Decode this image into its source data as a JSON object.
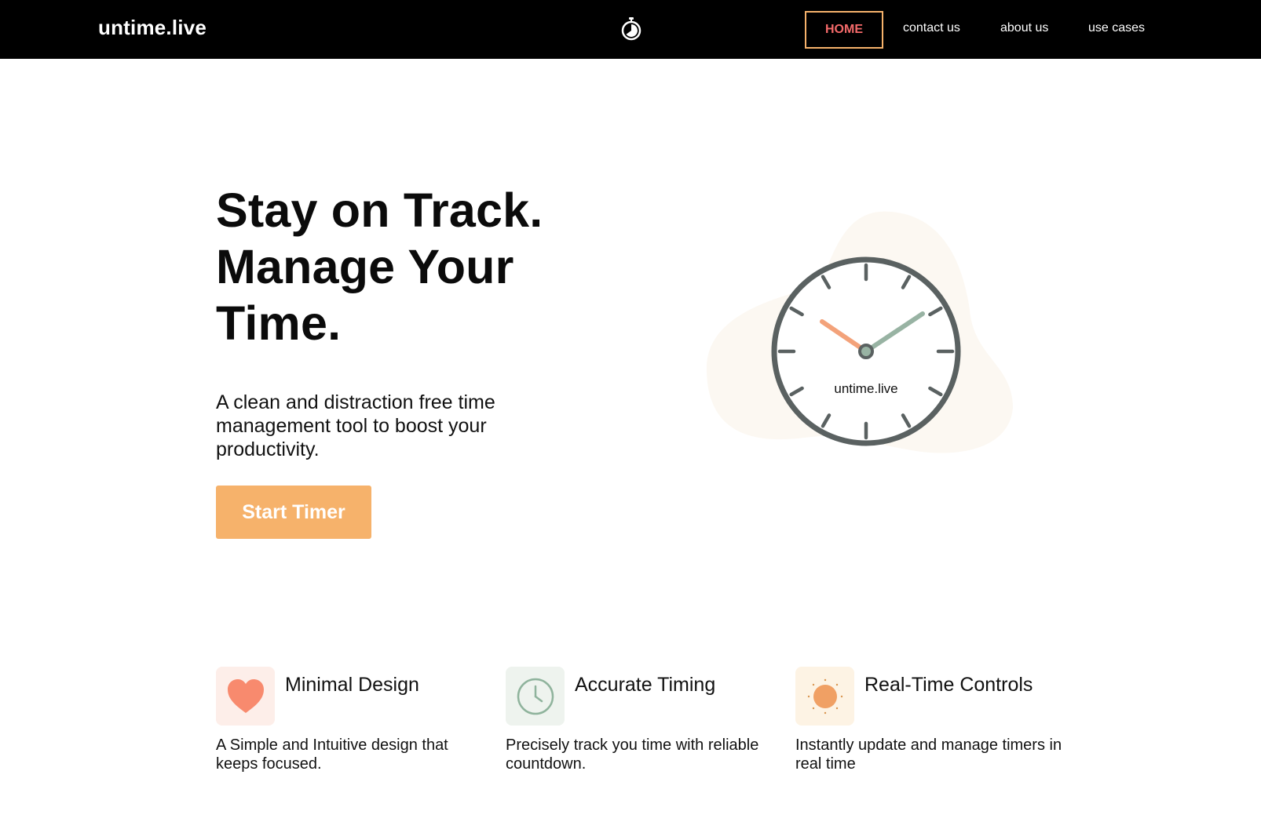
{
  "nav": {
    "brand": "untime.live",
    "logo_icon": "stopwatch-icon",
    "links": [
      {
        "label": "HOME",
        "active": true
      },
      {
        "label": "contact us"
      },
      {
        "label": "about us"
      },
      {
        "label": "use cases"
      }
    ]
  },
  "hero": {
    "title_lines": [
      "Stay on Track.",
      "Manage Your",
      "Time."
    ],
    "subtitle": "A clean and distraction free time management tool to boost your productivity.",
    "cta_label": "Start Timer",
    "clock_label": "untime.live"
  },
  "features": [
    {
      "icon": "heart-icon",
      "title": "Minimal Design",
      "description": "A Simple and Intuitive design that keeps focused."
    },
    {
      "icon": "clock-icon",
      "title": "Accurate Timing",
      "description": "Precisely track you time with reliable countdown."
    },
    {
      "icon": "sun-icon",
      "title": "Real-Time Controls",
      "description": "Instantly update and manage timers in real time"
    }
  ],
  "colors": {
    "nav_bg": "#000000",
    "accent": "#f6b26b",
    "home_text": "#f46a6a",
    "heart": "#f88a6e",
    "clock_icon": "#8fb39c",
    "sun": "#f0a064",
    "clock_face": "#5a6161",
    "hour_hand": "#f3a27a",
    "minute_hand": "#98b3a3",
    "blob": "#fcf8f2"
  }
}
